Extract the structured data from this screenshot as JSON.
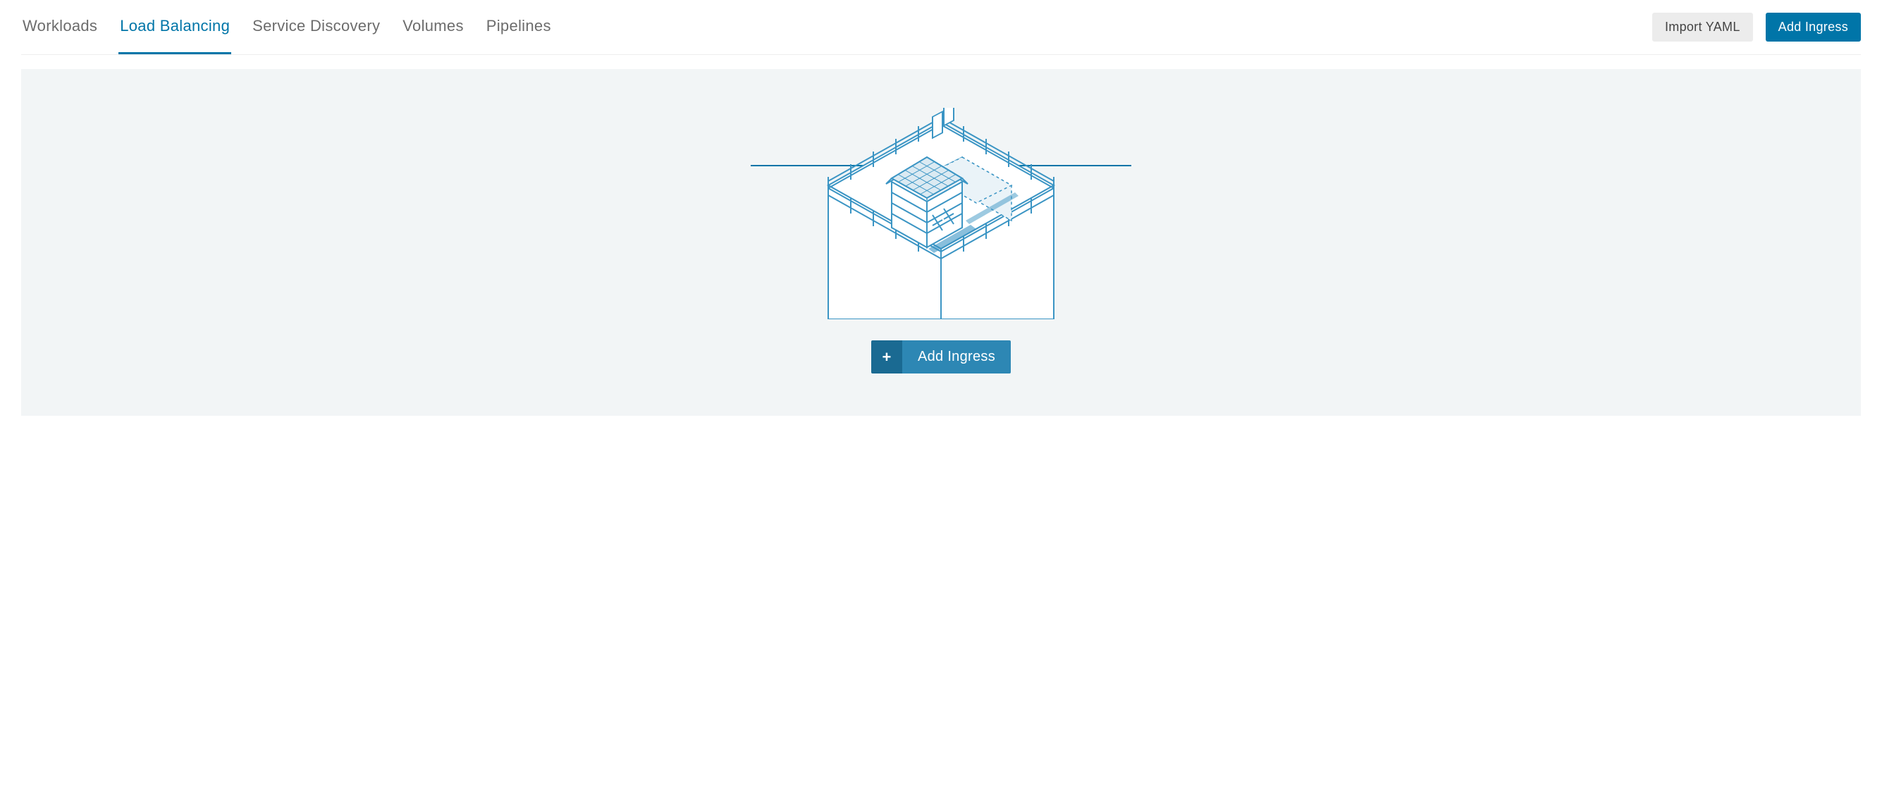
{
  "tabs": [
    {
      "label": "Workloads",
      "active": false
    },
    {
      "label": "Load Balancing",
      "active": true
    },
    {
      "label": "Service Discovery",
      "active": false
    },
    {
      "label": "Volumes",
      "active": false
    },
    {
      "label": "Pipelines",
      "active": false
    }
  ],
  "actions": {
    "import_yaml": "Import YAML",
    "add_ingress": "Add Ingress"
  },
  "empty_state": {
    "add_ingress_label": "Add Ingress"
  }
}
